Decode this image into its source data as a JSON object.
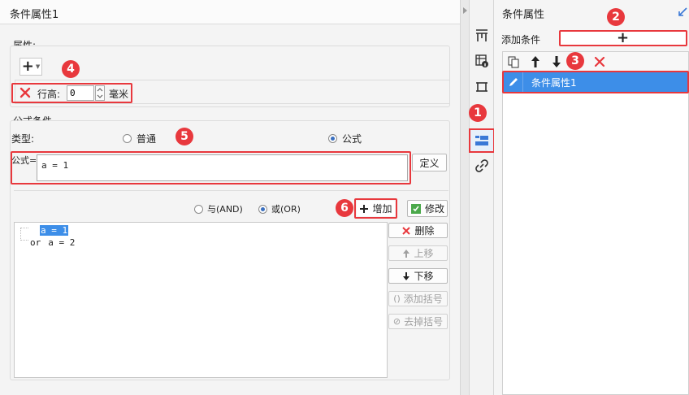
{
  "left_panel": {
    "title": "条件属性1",
    "properties": {
      "legend": "属性:",
      "add_symbol": "+",
      "row_height_label": "行高:",
      "row_height_value": "0",
      "unit": "毫米"
    },
    "formula_condition": {
      "legend": "公式条件",
      "type_label": "类型:",
      "type_options": [
        "普通",
        "公式"
      ],
      "selected_type": "公式",
      "formula_label": "公式=",
      "formula_value": "a = 1",
      "define_button": "定义",
      "logic_options": [
        "与(AND)",
        "或(OR)"
      ],
      "selected_logic": "或(OR)",
      "add_button": "增加",
      "modify_button": "修改",
      "conditions": [
        {
          "connector": "",
          "expr": "a = 1",
          "selected": true
        },
        {
          "connector": "or",
          "expr": "a = 2",
          "selected": false
        }
      ],
      "side_buttons": {
        "delete": "删除",
        "move_up": "上移",
        "move_down": "下移",
        "add_parens": "添加括号",
        "remove_parens": "去掉括号"
      }
    }
  },
  "right_panel": {
    "title": "条件属性",
    "add_condition_label": "添加条件",
    "add_symbol": "+",
    "list": [
      {
        "label": "条件属性1",
        "selected": true
      }
    ]
  },
  "badges": [
    "1",
    "2",
    "3",
    "4",
    "5",
    "6"
  ],
  "colors": {
    "highlight_red": "#e8383d",
    "selection_blue": "#3d8ee8",
    "toolbar_active_blue": "#3a78d6"
  },
  "icons": [
    "collapse-arrow-icon",
    "frozen-icon",
    "cell-info-icon",
    "cell-element-icon",
    "condition-attribute-icon",
    "hyperlink-icon",
    "copy-icon",
    "arrow-up-icon",
    "arrow-down-icon",
    "delete-icon",
    "edit-pencil-icon",
    "expand-corner-icon"
  ]
}
